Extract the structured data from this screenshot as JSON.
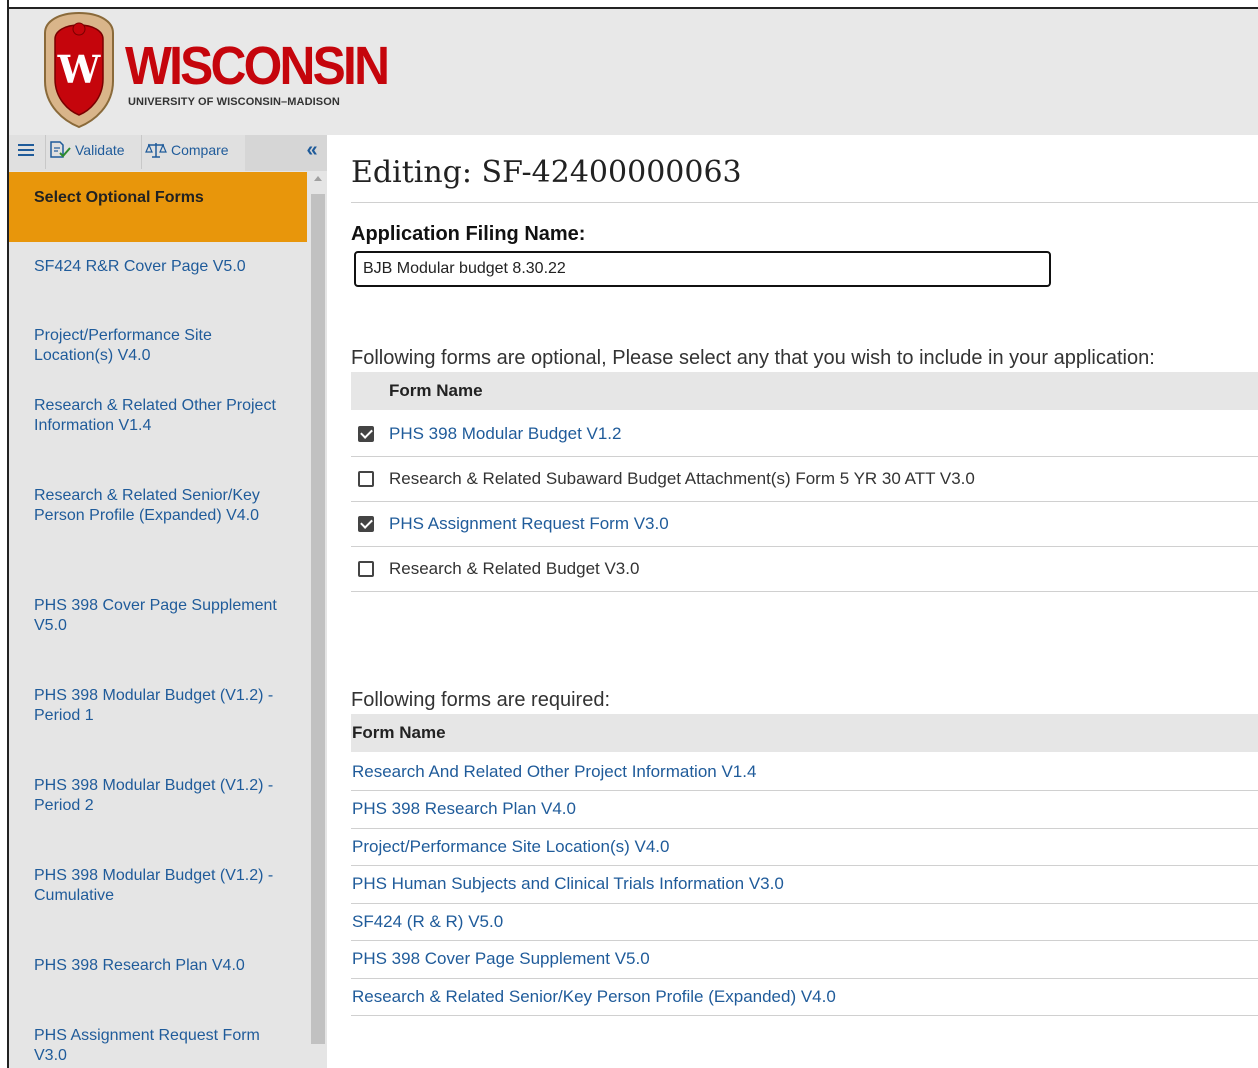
{
  "header": {
    "crest_letter": "W",
    "wordmark": "WISCONSIN",
    "subtitle": "UNIVERSITY OF WISCONSIN–MADISON"
  },
  "toolbar": {
    "validate_label": "Validate",
    "compare_label": "Compare",
    "collapse_glyph": "«"
  },
  "sidebar": {
    "items": [
      {
        "label": "Select Optional Forms",
        "active": true
      },
      {
        "label": "SF424 R&R Cover Page V5.0"
      },
      {
        "label": "Project/Performance Site Location(s) V4.0"
      },
      {
        "label": "Research & Related Other Project Information V1.4"
      },
      {
        "label": "Research & Related Senior/Key Person Profile (Expanded) V4.0"
      },
      {
        "label": "PHS 398 Cover Page Supplement V5.0"
      },
      {
        "label": "PHS 398 Modular Budget (V1.2) - Period 1"
      },
      {
        "label": "PHS 398 Modular Budget (V1.2) - Period 2"
      },
      {
        "label": "PHS 398 Modular Budget (V1.2) - Cumulative"
      },
      {
        "label": "PHS 398 Research Plan V4.0"
      },
      {
        "label": "PHS Assignment Request Form V3.0"
      }
    ]
  },
  "main": {
    "title": "Editing: SF-42400000063",
    "filing_label": "Application Filing Name:",
    "filing_value": "BJB Modular budget 8.30.22",
    "optional_intro": "Following forms are optional, Please select any that you wish to include in your application:",
    "optional_header": "Form Name",
    "optional_forms": [
      {
        "name": "PHS 398 Modular Budget V1.2",
        "checked": true
      },
      {
        "name": "Research & Related Subaward Budget Attachment(s) Form 5 YR 30 ATT V3.0",
        "checked": false
      },
      {
        "name": "PHS Assignment Request Form V3.0",
        "checked": true
      },
      {
        "name": "Research & Related Budget V3.0",
        "checked": false
      }
    ],
    "required_intro": "Following forms are required:",
    "required_header": "Form Name",
    "required_forms": [
      "Research And Related Other Project Information V1.4",
      "PHS 398 Research Plan V4.0",
      "Project/Performance Site Location(s) V4.0",
      "PHS Human Subjects and Clinical Trials Information V3.0",
      "SF424 (R & R) V5.0",
      "PHS 398 Cover Page Supplement V5.0",
      "Research & Related Senior/Key Person Profile (Expanded) V4.0"
    ]
  },
  "colors": {
    "link": "#1f5b9a",
    "active_nav": "#e8960b",
    "brand_red": "#c5050c"
  }
}
